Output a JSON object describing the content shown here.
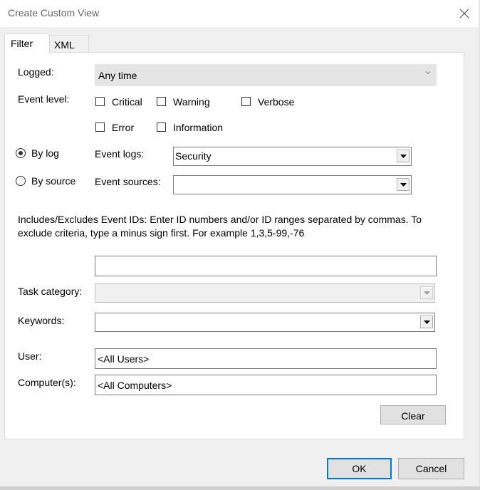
{
  "window": {
    "title": "Create Custom View"
  },
  "tabs": [
    {
      "label": "Filter",
      "active": true
    },
    {
      "label": "XML",
      "active": false
    }
  ],
  "filter": {
    "logged_label": "Logged:",
    "logged_value": "Any time",
    "event_level_label": "Event level:",
    "levels": {
      "critical": "Critical",
      "warning": "Warning",
      "verbose": "Verbose",
      "error": "Error",
      "information": "Information"
    },
    "by_log_label": "By log",
    "by_source_label": "By source",
    "event_logs_label": "Event logs:",
    "event_logs_value": "Security",
    "event_sources_label": "Event sources:",
    "event_sources_value": "",
    "event_ids_description": "Includes/Excludes Event IDs: Enter ID numbers and/or ID ranges separated by commas. To exclude criteria, type a minus sign first. For example 1,3,5-99,-76",
    "event_ids_value": "",
    "task_category_label": "Task category:",
    "task_category_value": "",
    "keywords_label": "Keywords:",
    "keywords_value": "",
    "user_label": "User:",
    "user_value": "<All Users>",
    "computers_label": "Computer(s):",
    "computers_value": "<All Computers>",
    "clear_label": "Clear"
  },
  "footer": {
    "ok_label": "OK",
    "cancel_label": "Cancel"
  }
}
